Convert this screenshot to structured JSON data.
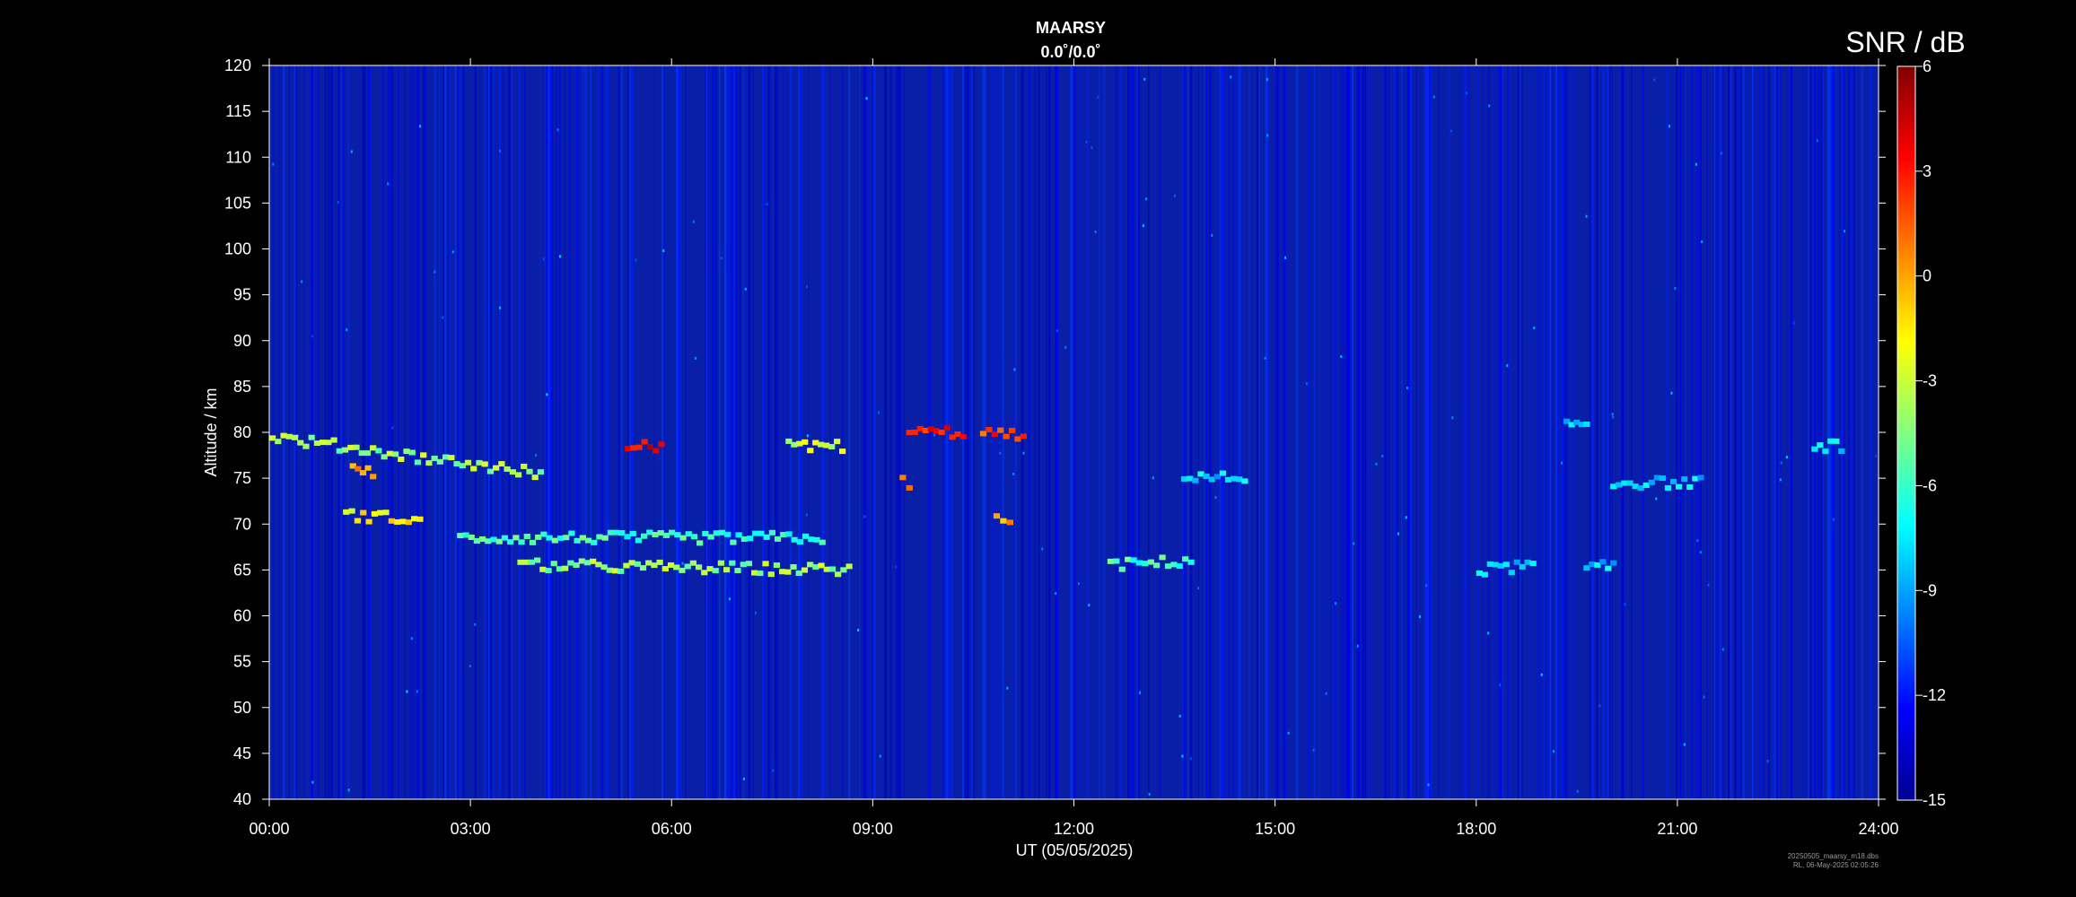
{
  "chart_data": {
    "type": "heatmap",
    "title": "MAARSY",
    "subtitle": "0.0˚/0.0˚",
    "xlabel": "UT (05/05/2025)",
    "ylabel": "Altitude / km",
    "x_ticks": [
      "00:00",
      "03:00",
      "06:00",
      "09:00",
      "12:00",
      "15:00",
      "18:00",
      "21:00",
      "24:00"
    ],
    "xlim_hours": [
      0,
      24
    ],
    "y_ticks": [
      "40",
      "45",
      "50",
      "55",
      "60",
      "65",
      "70",
      "75",
      "80",
      "85",
      "90",
      "95",
      "100",
      "105",
      "110",
      "115",
      "120"
    ],
    "ylim": [
      40,
      120
    ],
    "colorbar": {
      "title": "SNR / dB",
      "ticks": [
        "6",
        "3",
        "0",
        "-3",
        "-6",
        "-9",
        "-12",
        "-15"
      ],
      "range": [
        -15,
        6
      ],
      "colormap": "jet"
    },
    "background_level_db": -13,
    "echo_features": [
      {
        "t_start": 0.0,
        "t_end": 4.0,
        "alt_start": 79.5,
        "alt_end": 75.5,
        "snr_db": -4
      },
      {
        "t_start": 1.1,
        "t_end": 2.2,
        "alt_start": 71.0,
        "alt_end": 70.5,
        "snr_db": -2
      },
      {
        "t_start": 1.2,
        "t_end": 1.5,
        "alt_start": 76.0,
        "alt_end": 75.5,
        "snr_db": 0
      },
      {
        "t_start": 5.3,
        "t_end": 5.8,
        "alt_start": 78.5,
        "alt_end": 78.5,
        "snr_db": 4
      },
      {
        "t_start": 3.7,
        "t_end": 8.6,
        "alt_start": 65.5,
        "alt_end": 65.0,
        "snr_db": -4
      },
      {
        "t_start": 2.8,
        "t_end": 8.2,
        "alt_start": 68.5,
        "alt_end": 68.5,
        "snr_db": -6
      },
      {
        "t_start": 7.7,
        "t_end": 8.5,
        "alt_start": 78.5,
        "alt_end": 78.5,
        "snr_db": -3
      },
      {
        "t_start": 9.5,
        "t_end": 10.3,
        "alt_start": 80.0,
        "alt_end": 80.0,
        "snr_db": 3
      },
      {
        "t_start": 10.6,
        "t_end": 11.2,
        "alt_start": 80.0,
        "alt_end": 79.5,
        "snr_db": 2
      },
      {
        "t_start": 9.4,
        "t_end": 9.5,
        "alt_start": 74.5,
        "alt_end": 74.5,
        "snr_db": 0
      },
      {
        "t_start": 10.8,
        "t_end": 11.0,
        "alt_start": 70.5,
        "alt_end": 70.5,
        "snr_db": 0
      },
      {
        "t_start": 12.5,
        "t_end": 13.7,
        "alt_start": 65.5,
        "alt_end": 66.0,
        "snr_db": -6
      },
      {
        "t_start": 13.6,
        "t_end": 14.5,
        "alt_start": 75.0,
        "alt_end": 75.0,
        "snr_db": -8
      },
      {
        "t_start": 18.0,
        "t_end": 18.8,
        "alt_start": 65.0,
        "alt_end": 65.5,
        "snr_db": -8
      },
      {
        "t_start": 19.6,
        "t_end": 20.0,
        "alt_start": 65.0,
        "alt_end": 65.5,
        "snr_db": -8
      },
      {
        "t_start": 19.3,
        "t_end": 19.6,
        "alt_start": 81.0,
        "alt_end": 81.0,
        "snr_db": -8
      },
      {
        "t_start": 20.0,
        "t_end": 21.3,
        "alt_start": 74.5,
        "alt_end": 74.5,
        "snr_db": -8
      },
      {
        "t_start": 23.0,
        "t_end": 23.4,
        "alt_start": 78.5,
        "alt_end": 78.5,
        "snr_db": -8
      }
    ],
    "grid": false
  },
  "footer": {
    "line1": "20250505_maarsy_m18.dbs",
    "line2": "RL, 06-May-2025 02:05:26"
  }
}
